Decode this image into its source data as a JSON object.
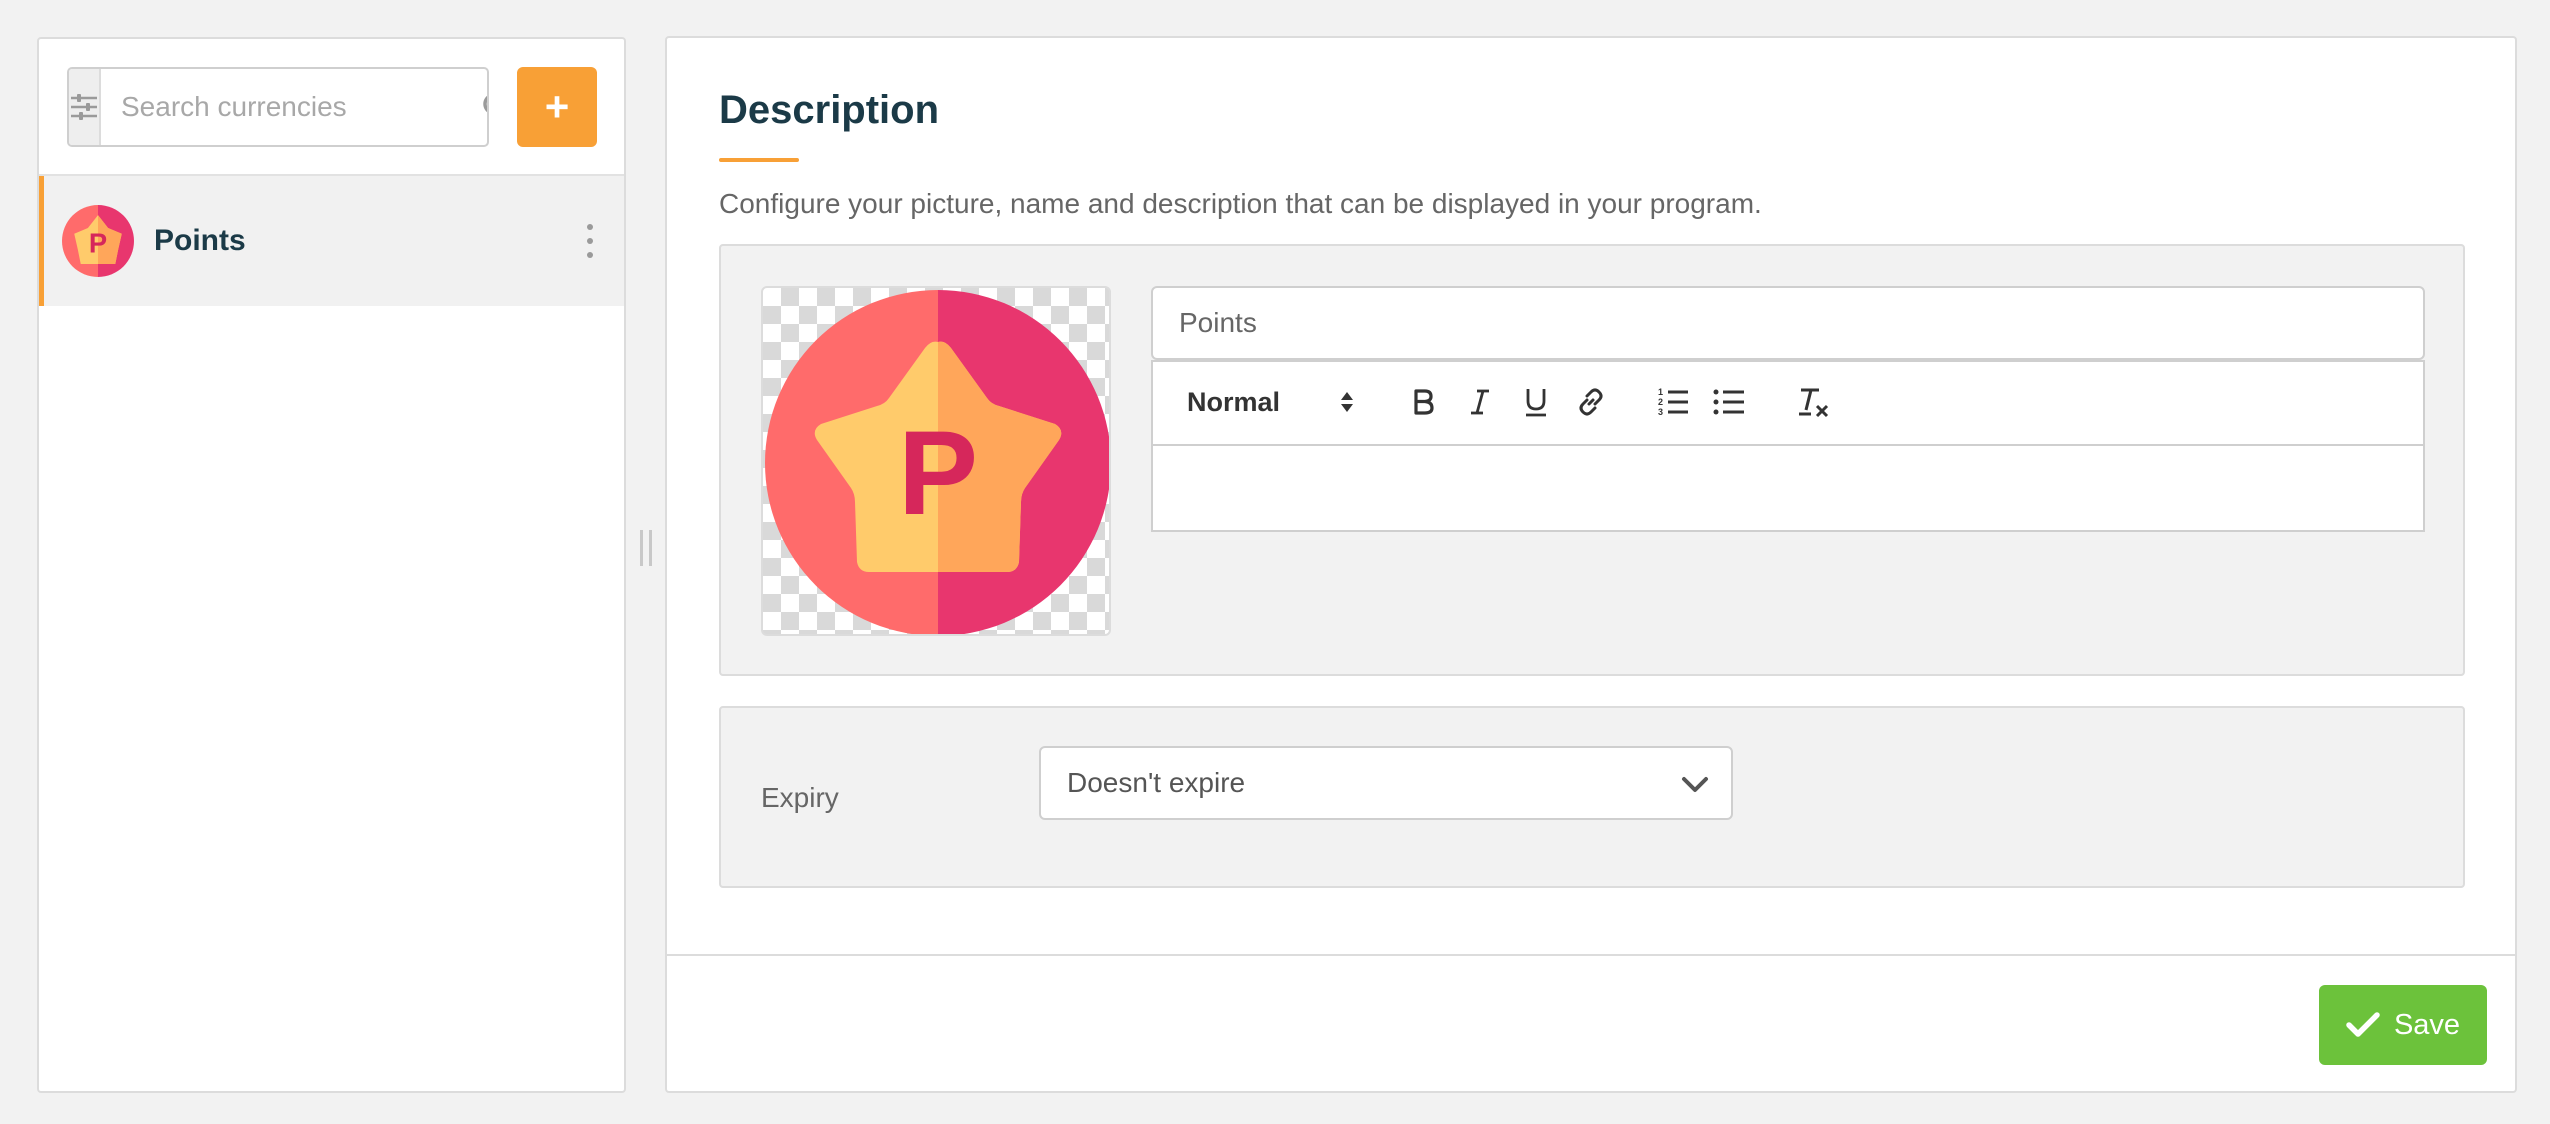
{
  "sidebar": {
    "search": {
      "placeholder": "Search currencies",
      "value": ""
    },
    "add_label": "+",
    "items": [
      {
        "name": "Points",
        "avatar_letter": "P",
        "selected": true
      }
    ]
  },
  "main": {
    "title": "Description",
    "description": "Configure your picture, name and description that can be displayed in your program.",
    "image_letter": "P",
    "name_value": "Points",
    "editor": {
      "format": "Normal",
      "tools": [
        "bold",
        "italic",
        "underline",
        "link",
        "ordered-list",
        "bullet-list",
        "clear-format"
      ],
      "content": ""
    },
    "expiry": {
      "label": "Expiry",
      "value": "Doesn't expire"
    },
    "save_label": "Save"
  },
  "colors": {
    "accent": "#f8a036",
    "save": "#6cc23b",
    "title": "#1b3a47",
    "coin_left": "#ff6b6b",
    "coin_right": "#e8366e",
    "star_left": "#ffcb6b",
    "star_right": "#ffa65a",
    "letter": "#d6275b"
  }
}
